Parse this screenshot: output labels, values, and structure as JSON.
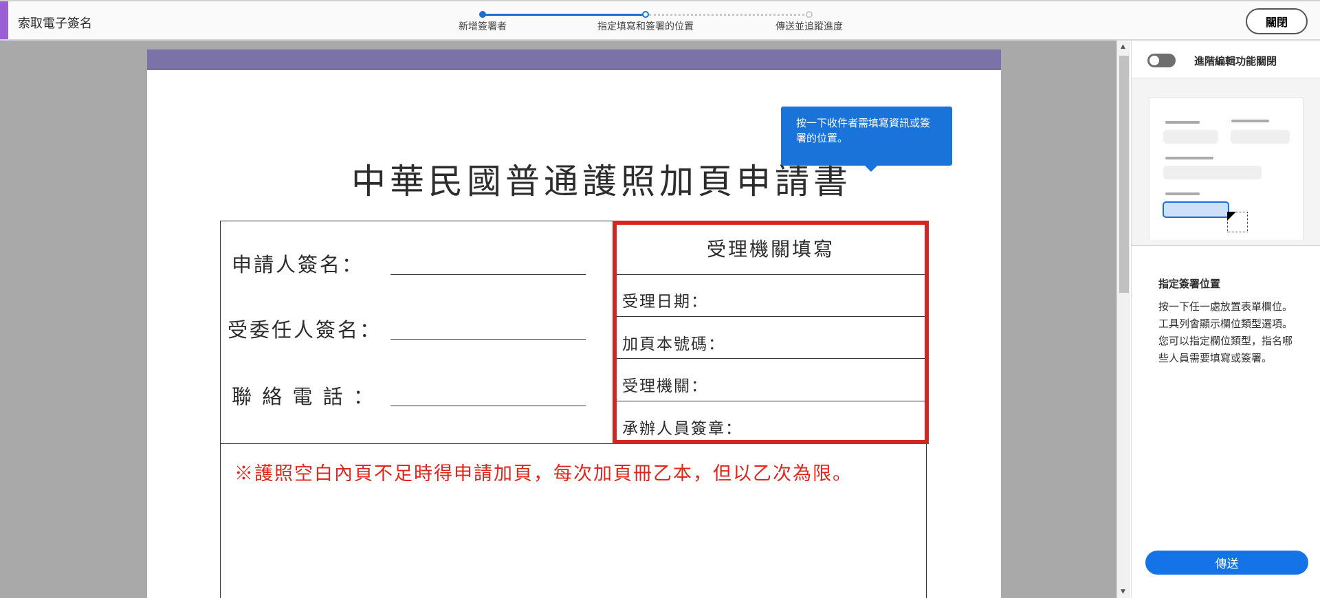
{
  "header": {
    "title": "索取電子簽名",
    "steps": [
      "新增簽署者",
      "指定填寫和簽署的位置",
      "傳送並追蹤進度"
    ],
    "current_step": 2,
    "close_label": "關閉"
  },
  "document": {
    "title": "中華民國普通護照加頁申請書",
    "left_labels": [
      "申請人簽名：",
      "受委任人簽名：",
      "聯 絡 電 話 ："
    ],
    "office_header": "受理機關填寫",
    "office_rows": [
      "受理日期：",
      "加頁本號碼：",
      "受理機關：",
      "承辦人員簽章："
    ],
    "note": "※護照空白內頁不足時得申請加頁，每次加頁冊乙本，但以乙次為限。"
  },
  "tooltip": {
    "text": "按一下收件者需填寫資訊或簽署的位置。"
  },
  "panel": {
    "toggle_label": "進階編輯功能關閉",
    "toggle_on": false,
    "section_title": "指定簽署位置",
    "section_body": "按一下任一處放置表單欄位。工具列會顯示欄位類型選項。您可以指定欄位類型，指名哪些人員需要填寫或簽署。",
    "send_label": "傳送"
  },
  "colors": {
    "accent": "#9a5fd6",
    "primary": "#1473e6",
    "highlight": "#d3261e"
  }
}
